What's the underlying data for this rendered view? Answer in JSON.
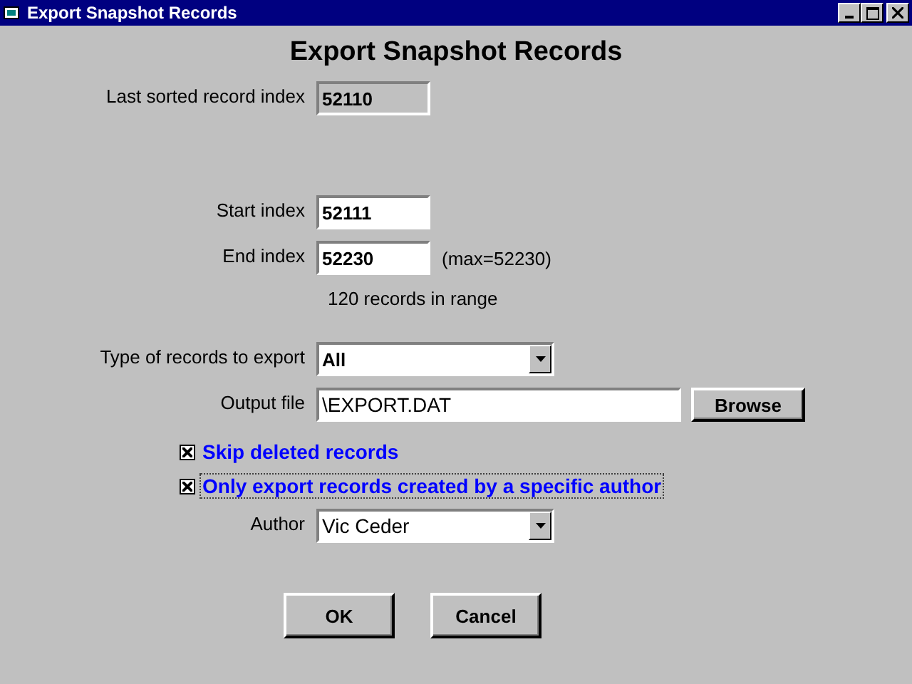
{
  "window": {
    "title": "Export Snapshot Records"
  },
  "heading": "Export Snapshot Records",
  "last_sorted": {
    "label": "Last sorted record index",
    "value": "52110",
    "disabled": true
  },
  "start_index": {
    "label": "Start index",
    "value": "52111"
  },
  "end_index": {
    "label": "End index",
    "value": "52230",
    "note": "(max=52230)"
  },
  "range_text": "120 records in range",
  "record_type": {
    "label": "Type of records to export",
    "value": "All"
  },
  "output_file": {
    "label": "Output file",
    "value": "\\EXPORT.DAT",
    "button": "Browse"
  },
  "checkboxes": [
    {
      "label": "Skip deleted records",
      "checked": true,
      "focused": false
    },
    {
      "label": "Only export records created by a specific author",
      "checked": true,
      "focused": true
    }
  ],
  "author": {
    "label": "Author",
    "value": "Vic Ceder"
  },
  "buttons": [
    {
      "label": "OK"
    },
    {
      "label": "Cancel"
    }
  ]
}
